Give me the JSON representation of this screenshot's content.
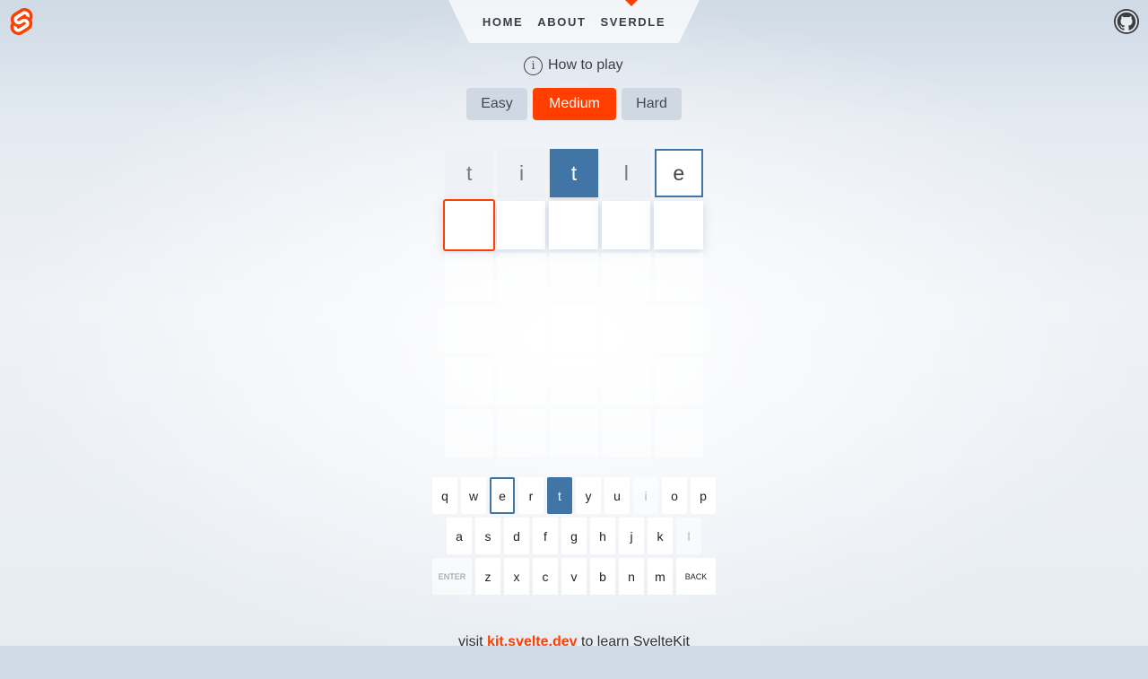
{
  "header": {
    "nav": [
      {
        "label": "Home"
      },
      {
        "label": "About"
      },
      {
        "label": "Sverdle"
      }
    ],
    "active_index": 2
  },
  "howto": {
    "label": "How to play",
    "icon": "info-icon"
  },
  "difficulty": {
    "options": [
      "Easy",
      "Medium",
      "Hard"
    ],
    "selected": "Medium"
  },
  "board": {
    "guess_row": [
      {
        "letter": "t",
        "state": "missing"
      },
      {
        "letter": "i",
        "state": "missing"
      },
      {
        "letter": "t",
        "state": "exact"
      },
      {
        "letter": "l",
        "state": "missing"
      },
      {
        "letter": "e",
        "state": "close"
      }
    ],
    "rows": 6,
    "columns": 5
  },
  "keyboard": {
    "row1": [
      "q",
      "w",
      "e",
      "r",
      "t",
      "y",
      "u",
      "i",
      "o",
      "p"
    ],
    "row2": [
      "a",
      "s",
      "d",
      "f",
      "g",
      "h",
      "j",
      "k",
      "l"
    ],
    "row3": [
      "z",
      "x",
      "c",
      "v",
      "b",
      "n",
      "m"
    ],
    "enter_label": "enter",
    "back_label": "back",
    "exact": [
      "t"
    ],
    "close": [
      "e"
    ],
    "missing": [
      "i",
      "l"
    ]
  },
  "footer": {
    "prefix": "visit",
    "link": "kit.svelte.dev",
    "suffix": "to learn SvelteKit"
  },
  "colors": {
    "accent": "#ff3e00",
    "exact": "#4075a6"
  }
}
